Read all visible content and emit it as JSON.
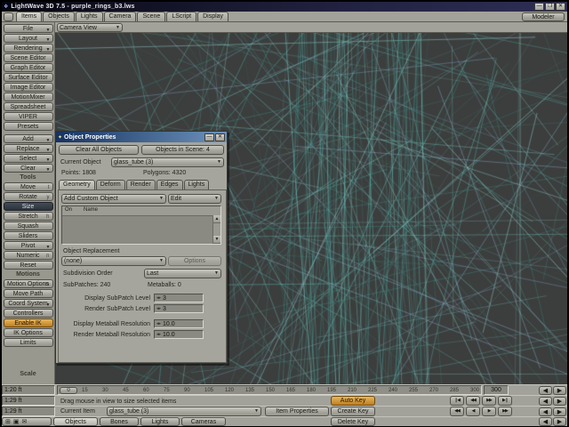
{
  "titlebar": {
    "title": "LightWave 3D 7.5 - purple_rings_b3.lws"
  },
  "icons": {
    "app": "❖",
    "dropdown_arrow": "▼",
    "minimize": "—",
    "maximize": "❒",
    "close": "✕",
    "panel_bullet": "✦",
    "scroll_up": "▲",
    "scroll_down": "▼",
    "mini_slider": "◂▸",
    "taskbar": [
      "⊞",
      "▣",
      "✉"
    ]
  },
  "menubar": {
    "tabs": [
      "Items",
      "Objects",
      "Lights",
      "Camera",
      "Scene",
      "LScript",
      "Display"
    ],
    "active_tab": "Items",
    "modeler_label": "Modeler"
  },
  "viewbar": {
    "view_selector": "Camera View"
  },
  "sidebar": {
    "items": [
      {
        "label": "File",
        "arrow": true
      },
      {
        "label": "Layout",
        "arrow": true
      },
      {
        "label": "Rendering",
        "arrow": true
      },
      {
        "label": "Scene Editor"
      },
      {
        "label": "Graph Editor"
      },
      {
        "label": "Surface Editor"
      },
      {
        "label": "Image Editor"
      },
      {
        "label": "MotionMixer"
      },
      {
        "label": "Spreadsheet"
      },
      {
        "label": "VIPER"
      },
      {
        "label": "Presets"
      },
      {
        "type": "gap"
      },
      {
        "label": "Add",
        "arrow": true
      },
      {
        "label": "Replace",
        "arrow": true
      },
      {
        "label": "Select",
        "arrow": true
      },
      {
        "label": "Clear",
        "arrow": true
      },
      {
        "type": "header",
        "label": "Tools"
      },
      {
        "label": "Move",
        "shortcut": "t"
      },
      {
        "label": "Rotate",
        "shortcut": "y"
      },
      {
        "label": "Size",
        "shortcut": "H",
        "state": "pressed"
      },
      {
        "label": "Stretch",
        "shortcut": "h"
      },
      {
        "label": "Squash"
      },
      {
        "label": "Sliders"
      },
      {
        "label": "Pivot",
        "arrow": true
      },
      {
        "label": "Numeric",
        "shortcut": "n"
      },
      {
        "label": "Reset"
      },
      {
        "type": "header",
        "label": "Motions"
      },
      {
        "label": "Motion Options",
        "shortcut": "m"
      },
      {
        "label": "Move Path"
      },
      {
        "label": "Coord System",
        "arrow": true
      },
      {
        "label": "Controllers"
      },
      {
        "label": "Enable IK",
        "state": "amber"
      },
      {
        "label": "IK Options"
      },
      {
        "label": "Limits"
      },
      {
        "type": "spacer"
      },
      {
        "type": "header",
        "label": "Scale"
      }
    ]
  },
  "properties_panel": {
    "title": "Object Properties",
    "clear_all_label": "Clear All Objects",
    "objects_in_scene": "Objects in Scene: 4",
    "current_object_label": "Current Object",
    "current_object_value": "glass_tube (3)",
    "points": "Points: 1808",
    "polygons": "Polygons: 4320",
    "tabs": [
      "Geometry",
      "Deform",
      "Render",
      "Edges",
      "Lights"
    ],
    "active_tab": "Geometry",
    "add_custom_object_label": "Add Custom Object",
    "edit_label": "Edit",
    "list_header_on": "On",
    "list_header_name": "Name",
    "object_replacement_label": "Object Replacement",
    "replacement_value": "(none)",
    "options_label": "Options",
    "subdivision_order_label": "Subdivision Order",
    "subdivision_order_value": "Last",
    "subpatches": "SubPatches: 240",
    "metaballs": "Metaballs: 0",
    "display_subpatch_label": "Display SubPatch Level",
    "display_subpatch_value": "3",
    "render_subpatch_label": "Render SubPatch Level",
    "render_subpatch_value": "3",
    "display_metaball_label": "Display Metaball Resolution",
    "display_metaball_value": "10.0",
    "render_metaball_label": "Render Metaball Resolution",
    "render_metaball_value": "10.0"
  },
  "timeline": {
    "ticks": [
      "0",
      "15",
      "30",
      "45",
      "60",
      "75",
      "90",
      "105",
      "120",
      "135",
      "150",
      "165",
      "180",
      "195",
      "210",
      "225",
      "240",
      "255",
      "270",
      "285",
      "300"
    ],
    "current_frame": "0",
    "last_frame": "300"
  },
  "scale_readouts": [
    "1:20 ft",
    "1:29 ft",
    "1:29 ft"
  ],
  "statusbar": {
    "hint": "Drag mouse in view to size selected items"
  },
  "item_row": {
    "current_item_label": "Current Item",
    "current_item_value": "glass_tube (3)",
    "item_properties_label": "Item Properties"
  },
  "type_row": {
    "buttons": [
      "Objects",
      "Bones",
      "Lights",
      "Cameras"
    ],
    "active": "Objects"
  },
  "key_controls": {
    "auto_key": "Auto Key",
    "create_key": "Create Key",
    "delete_key": "Delete Key"
  },
  "transport": {
    "row1": [
      "❙◀",
      "◀◀",
      "▶▶",
      "▶❙"
    ],
    "row2": [
      "◀◀",
      "◀",
      "▶",
      "▶▶"
    ],
    "edge_left": "◀",
    "edge_right": "▶"
  },
  "viewport": {
    "bg": "#3b3e3d",
    "wire_colors": [
      "#7fd8d2",
      "#54b6b0",
      "#3c928c",
      "#a9f2ec",
      "#69c6c0",
      "#93b4da"
    ]
  }
}
